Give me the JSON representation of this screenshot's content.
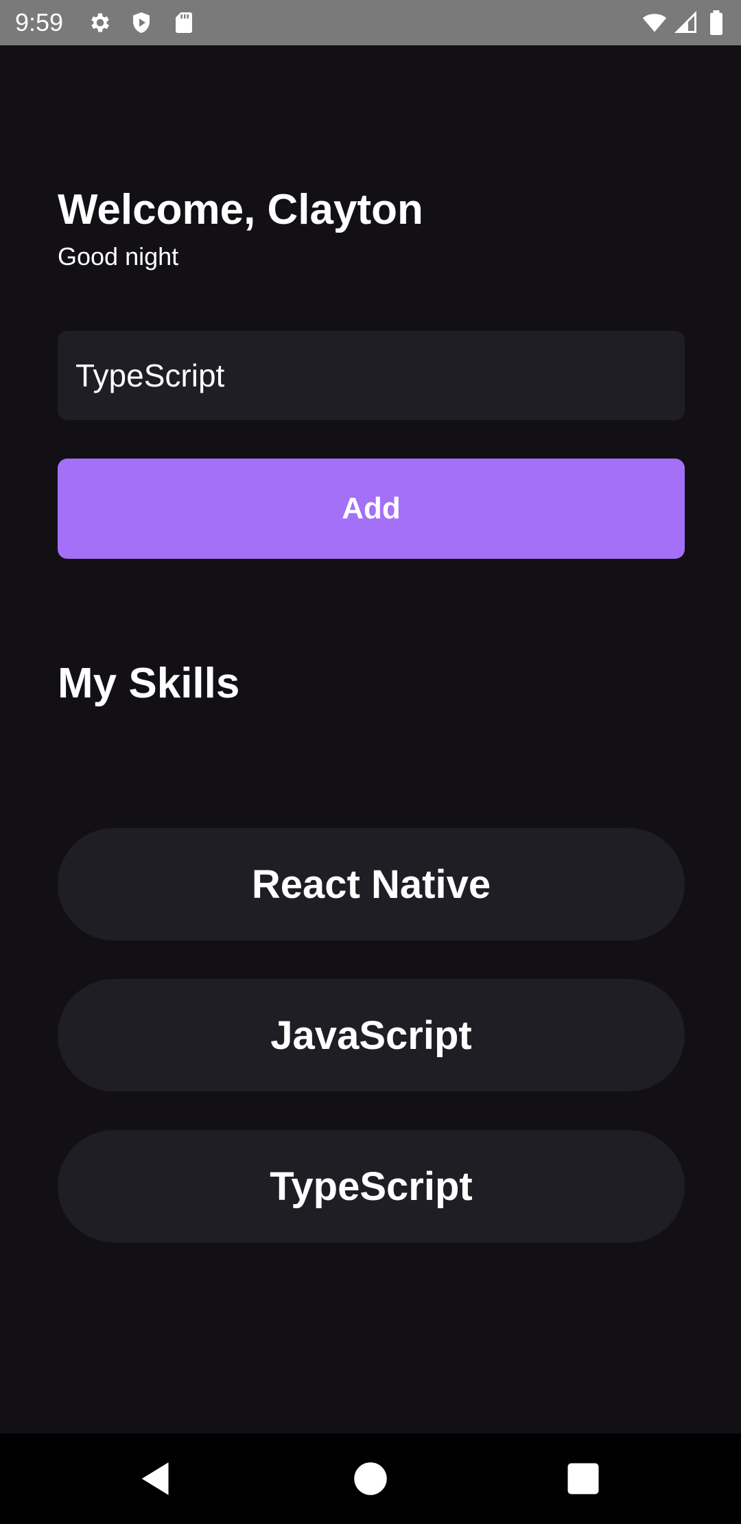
{
  "status_bar": {
    "time": "9:59",
    "left_icons": [
      "gear-icon",
      "shield-icon",
      "sd-card-icon"
    ],
    "right_icons": [
      "wifi-icon",
      "signal-icon",
      "battery-icon"
    ]
  },
  "header": {
    "welcome": "Welcome, Clayton",
    "greeting": "Good night"
  },
  "input": {
    "value": "TypeScript",
    "placeholder": ""
  },
  "add_button": {
    "label": "Add"
  },
  "skills_section": {
    "title": "My Skills",
    "items": [
      {
        "label": "React Native"
      },
      {
        "label": "JavaScript"
      },
      {
        "label": "TypeScript"
      }
    ]
  },
  "nav_bar": {
    "icons": [
      "back-icon",
      "home-icon",
      "recents-icon"
    ]
  },
  "colors": {
    "background": "#121015",
    "surface": "#1f1e25",
    "accent": "#a370f7",
    "status_bar": "#7a7a7a",
    "text": "#ffffff"
  }
}
